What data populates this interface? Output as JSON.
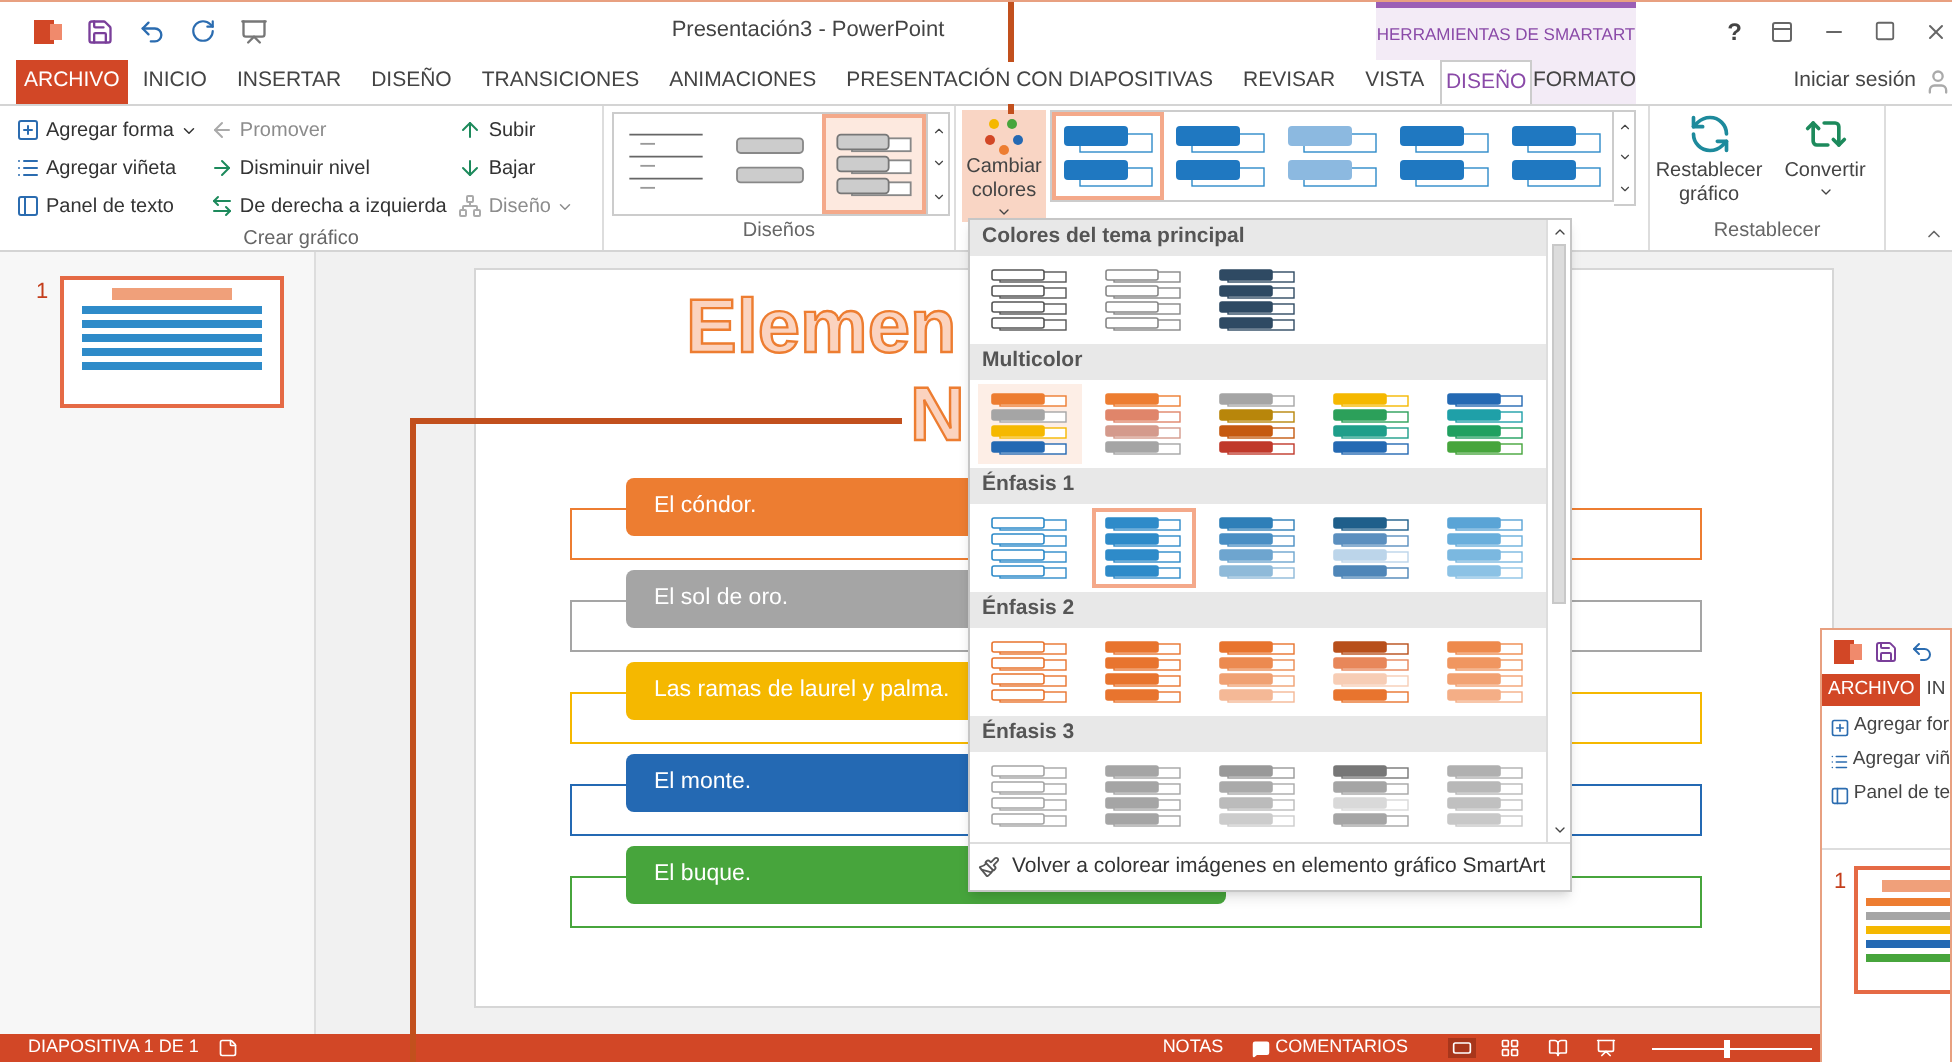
{
  "title_bar": {
    "title": "Presentación3 - PowerPoint",
    "context_group": "HERRAMIENTAS DE SMARTART",
    "help": "?"
  },
  "tabs": [
    {
      "label": "ARCHIVO",
      "kind": "file",
      "selected": false
    },
    {
      "label": "INICIO",
      "kind": "tab",
      "selected": false
    },
    {
      "label": "INSERTAR",
      "kind": "tab",
      "selected": false
    },
    {
      "label": "DISEÑO",
      "kind": "tab",
      "selected": false
    },
    {
      "label": "TRANSICIONES",
      "kind": "tab",
      "selected": false
    },
    {
      "label": "ANIMACIONES",
      "kind": "tab",
      "selected": false
    },
    {
      "label": "PRESENTACIÓN CON DIAPOSITIVAS",
      "kind": "tab",
      "selected": false
    },
    {
      "label": "REVISAR",
      "kind": "tab",
      "selected": false
    },
    {
      "label": "VISTA",
      "kind": "tab",
      "selected": false
    },
    {
      "label": "DISEÑO",
      "kind": "context",
      "selected": true
    },
    {
      "label": "FORMATO",
      "kind": "context",
      "selected": false
    }
  ],
  "sign_in": "Iniciar sesión",
  "ribbon": {
    "create_group": {
      "label": "Crear gráfico",
      "columns": [
        [
          {
            "label": "Agregar forma",
            "dropdown": true,
            "disabled": false
          },
          {
            "label": "Agregar viñeta",
            "dropdown": false,
            "disabled": false
          },
          {
            "label": "Panel de texto",
            "dropdown": false,
            "disabled": false
          }
        ],
        [
          {
            "label": "Promover",
            "dropdown": false,
            "disabled": true
          },
          {
            "label": "Disminuir nivel",
            "dropdown": false,
            "disabled": false
          },
          {
            "label": "De derecha a izquierda",
            "dropdown": false,
            "disabled": false
          }
        ],
        [
          {
            "label": "Subir",
            "dropdown": false,
            "disabled": false
          },
          {
            "label": "Bajar",
            "dropdown": false,
            "disabled": false
          },
          {
            "label": "Diseño",
            "dropdown": true,
            "disabled": true
          }
        ]
      ]
    },
    "layouts_group": {
      "label": "Diseños",
      "layouts": [
        {
          "selected": false
        },
        {
          "selected": false
        },
        {
          "selected": true
        }
      ]
    },
    "color_button": {
      "label": "Cambiar colores",
      "expanded": true
    },
    "styles": [
      {
        "selected": true
      },
      {
        "selected": false
      },
      {
        "selected": false
      },
      {
        "selected": false
      },
      {
        "selected": false
      }
    ],
    "reset_group": {
      "label": "Restablecer",
      "buttons": [
        {
          "label": "Restablecer gráfico",
          "dropdown": false
        },
        {
          "label": "Convertir",
          "dropdown": true
        }
      ]
    }
  },
  "thumbnails": [
    {
      "number": "1",
      "selected": true
    }
  ],
  "slide": {
    "title_lines": [
      "Elemen",
      "N"
    ],
    "items": [
      {
        "text": "El cóndor.",
        "color": "#ed7d31"
      },
      {
        "text": "El sol de oro.",
        "color": "#a5a5a5"
      },
      {
        "text": "Las ramas de laurel y palma.",
        "color": "#f5b800"
      },
      {
        "text": "El monte.",
        "color": "#2469b3"
      },
      {
        "text": "El buque.",
        "color": "#47a53c"
      }
    ]
  },
  "dropdown": {
    "sections": [
      {
        "title": "Colores del tema principal",
        "swatches": [
          {
            "selected": false,
            "hovered": false
          },
          {
            "selected": false,
            "hovered": false
          },
          {
            "selected": false,
            "hovered": false
          }
        ]
      },
      {
        "title": "Multicolor",
        "swatches": [
          {
            "selected": false,
            "hovered": true
          },
          {
            "selected": false,
            "hovered": false
          },
          {
            "selected": false,
            "hovered": false
          },
          {
            "selected": false,
            "hovered": false
          },
          {
            "selected": false,
            "hovered": false
          }
        ]
      },
      {
        "title": "Énfasis 1",
        "swatches": [
          {
            "selected": false,
            "hovered": false
          },
          {
            "selected": true,
            "hovered": false
          },
          {
            "selected": false,
            "hovered": false
          },
          {
            "selected": false,
            "hovered": false
          },
          {
            "selected": false,
            "hovered": false
          }
        ]
      },
      {
        "title": "Énfasis 2",
        "swatches": [
          {
            "selected": false,
            "hovered": false
          },
          {
            "selected": false,
            "hovered": false
          },
          {
            "selected": false,
            "hovered": false
          },
          {
            "selected": false,
            "hovered": false
          },
          {
            "selected": false,
            "hovered": false
          }
        ]
      },
      {
        "title": "Énfasis 3",
        "swatches": [
          {
            "selected": false,
            "hovered": false
          },
          {
            "selected": false,
            "hovered": false
          },
          {
            "selected": false,
            "hovered": false
          },
          {
            "selected": false,
            "hovered": false
          },
          {
            "selected": false,
            "hovered": false
          }
        ]
      }
    ],
    "footer": "Volver a colorear imágenes en elemento gráfico SmartArt"
  },
  "status_bar": {
    "slide_info": "DIAPOSITIVA 1 DE 1",
    "notes": "NOTAS",
    "comments": "COMENTARIOS",
    "views": [
      {
        "selected": true
      },
      {
        "selected": false
      },
      {
        "selected": false
      },
      {
        "selected": false
      }
    ],
    "zoom": {
      "level": 0.45
    }
  },
  "second_window": {
    "tabs": [
      "ARCHIVO",
      "IN"
    ],
    "commands": [
      "Agregar for",
      "Agregar viñ",
      "Panel de te"
    ],
    "thumbnail_number": "1"
  }
}
